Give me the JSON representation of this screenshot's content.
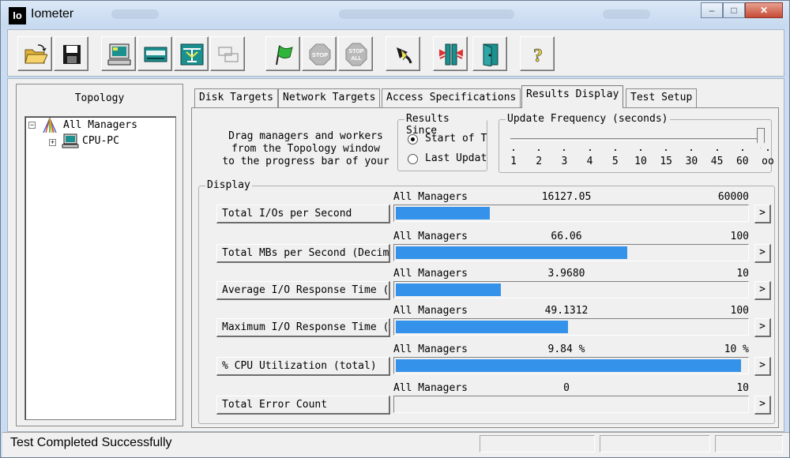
{
  "window": {
    "app_icon_text": "Io",
    "title": "Iometer",
    "caption": {
      "minimize": "–",
      "maximize": "□",
      "close": "✕"
    }
  },
  "toolbar": {
    "buttons": [
      {
        "name": "open-config-button",
        "icon": "folder-open-icon"
      },
      {
        "name": "save-config-button",
        "icon": "floppy-disk-icon"
      },
      {
        "name": "new-manager-button",
        "icon": "computer-icon"
      },
      {
        "name": "new-disk-worker-button",
        "icon": "disk-worker-icon"
      },
      {
        "name": "new-network-worker-button",
        "icon": "network-worker-icon"
      },
      {
        "name": "duplicate-worker-button",
        "icon": "duplicate-icon",
        "disabled": true
      },
      {
        "name": "start-tests-button",
        "icon": "green-flag-icon"
      },
      {
        "name": "stop-button",
        "icon": "stop-sign-icon",
        "label": "STOP",
        "disabled": true
      },
      {
        "name": "stop-all-button",
        "icon": "stop-all-icon",
        "label": "STOP ALL",
        "disabled": true
      },
      {
        "name": "reset-workers-button",
        "icon": "reset-arrow-icon"
      },
      {
        "name": "disconnect-workers-button",
        "icon": "disconnect-icon"
      },
      {
        "name": "exit-button",
        "icon": "exit-door-icon"
      },
      {
        "name": "help-button",
        "icon": "question-mark-icon",
        "label": "?"
      }
    ]
  },
  "topology": {
    "title": "Topology",
    "root": "All Managers",
    "child": "CPU-PC"
  },
  "tabs": [
    "Disk Targets",
    "Network Targets",
    "Access Specifications",
    "Results Display",
    "Test Setup"
  ],
  "active_tab": "Results Display",
  "instructions": {
    "line1": "Drag managers and workers",
    "line2": "from the Topology window",
    "line3": "to the progress bar of your"
  },
  "results_since": {
    "label": "Results Since",
    "option1": "Start of T",
    "option2": "Last Updat",
    "selected": "Start of T"
  },
  "update_frequency": {
    "label": "Update Frequency (seconds)",
    "ticks": [
      "1",
      "2",
      "3",
      "4",
      "5",
      "10",
      "15",
      "30",
      "45",
      "60",
      "oo"
    ],
    "selected": "oo"
  },
  "display": {
    "label": "Display",
    "rows": [
      {
        "metric": "Total I/Os per Second",
        "source": "All Managers",
        "value": "16127.05",
        "max": "60000",
        "fill": 0.269,
        "arrow": ">"
      },
      {
        "metric": "Total MBs per Second (Decima",
        "source": "All Managers",
        "value": "66.06",
        "max": "100",
        "fill": 0.661,
        "arrow": ">"
      },
      {
        "metric": "Average I/O Response Time (m",
        "source": "All Managers",
        "value": "3.9680",
        "max": "10",
        "fill": 0.3,
        "arrow": ">"
      },
      {
        "metric": "Maximum I/O Response Time (m",
        "source": "All Managers",
        "value": "49.1312",
        "max": "100",
        "fill": 0.491,
        "arrow": ">"
      },
      {
        "metric": "% CPU Utilization (total)",
        "source": "All Managers",
        "value": "9.84 %",
        "max": "10 %",
        "fill": 0.984,
        "arrow": ">"
      },
      {
        "metric": "Total Error Count",
        "source": "All Managers",
        "value": "0",
        "max": "10",
        "fill": 0,
        "arrow": ">"
      }
    ]
  },
  "status": {
    "text": "Test Completed Successfully"
  },
  "colors": {
    "bar": "#3592ea",
    "window_frame": "#c9dcf1",
    "panel": "#f0f0f0"
  }
}
